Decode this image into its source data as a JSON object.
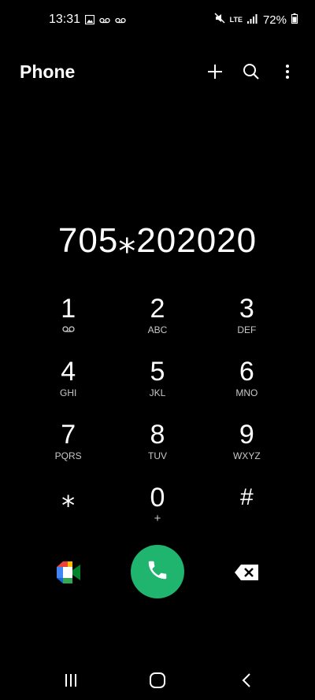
{
  "status_bar": {
    "time": "13:31",
    "battery": "72%",
    "network": "LTE",
    "icons": [
      "image-icon",
      "voicemail-icon",
      "mute-icon",
      "signal-icon",
      "battery-icon"
    ]
  },
  "header": {
    "title": "Phone",
    "actions": [
      "add-icon",
      "search-icon",
      "more-options-icon"
    ]
  },
  "dialer": {
    "number": "705⁎202020"
  },
  "keypad": {
    "keys": [
      {
        "digit": "1",
        "sub": ""
      },
      {
        "digit": "2",
        "sub": "ABC"
      },
      {
        "digit": "3",
        "sub": "DEF"
      },
      {
        "digit": "4",
        "sub": "GHI"
      },
      {
        "digit": "5",
        "sub": "JKL"
      },
      {
        "digit": "6",
        "sub": "MNO"
      },
      {
        "digit": "7",
        "sub": "PQRS"
      },
      {
        "digit": "8",
        "sub": "TUV"
      },
      {
        "digit": "9",
        "sub": "WXYZ"
      },
      {
        "digit": "⁎",
        "sub": ""
      },
      {
        "digit": "0",
        "sub": "+"
      },
      {
        "digit": "#",
        "sub": ""
      }
    ]
  },
  "colors": {
    "background": "#000000",
    "call_green": "#1fb56e",
    "text": "#ffffff"
  }
}
